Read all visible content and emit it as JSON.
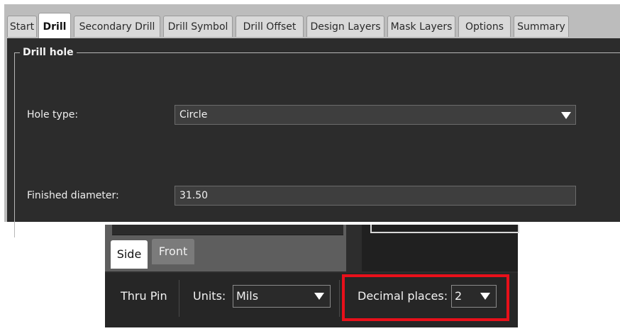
{
  "tabs": [
    {
      "label": "Start"
    },
    {
      "label": "Drill",
      "active": true
    },
    {
      "label": "Secondary Drill"
    },
    {
      "label": "Drill Symbol"
    },
    {
      "label": "Drill Offset"
    },
    {
      "label": "Design Layers"
    },
    {
      "label": "Mask Layers"
    },
    {
      "label": "Options"
    },
    {
      "label": "Summary"
    }
  ],
  "drill_hole": {
    "group_title": "Drill hole",
    "hole_type_label": "Hole type:",
    "hole_type_value": "Circle",
    "finished_diameter_label": "Finished diameter:",
    "finished_diameter_value": "31.50"
  },
  "bottom": {
    "side_tab": "Side",
    "front_tab": "Front",
    "thru_pin": "Thru Pin",
    "units_label": "Units:",
    "units_value": "Mils",
    "decimal_label": "Decimal places:",
    "decimal_value": "2"
  },
  "colors": {
    "highlight": "#e8101a",
    "panel_bg": "#2c2c2c"
  }
}
